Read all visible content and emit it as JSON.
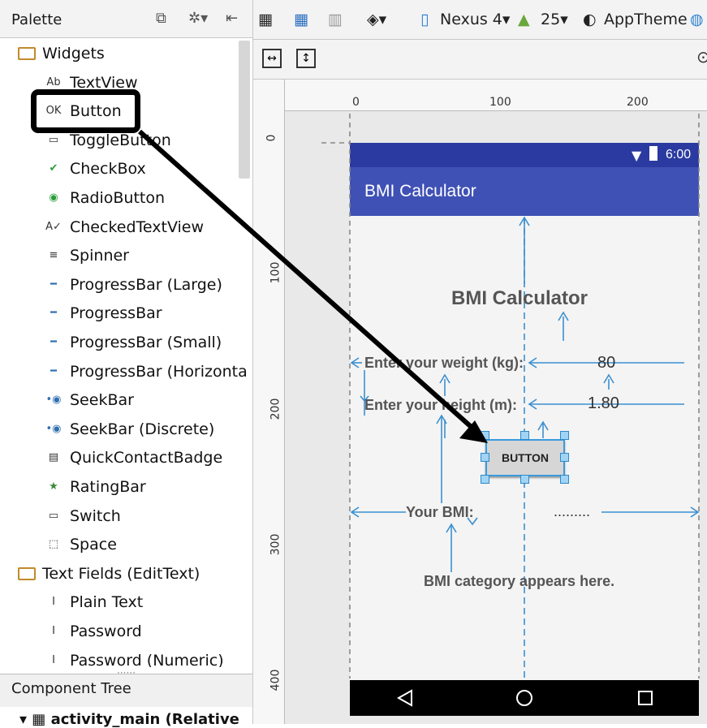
{
  "palette": {
    "title": "Palette",
    "items": [
      {
        "label": "Widgets",
        "icon": "folder-icon",
        "type": "folder"
      },
      {
        "label": "TextView",
        "icon": "textview-icon",
        "type": "item"
      },
      {
        "label": "Button",
        "icon": "button-icon",
        "type": "item"
      },
      {
        "label": "ToggleButton",
        "icon": "togglebutton-icon",
        "type": "item"
      },
      {
        "label": "CheckBox",
        "icon": "checkbox-icon",
        "type": "item"
      },
      {
        "label": "RadioButton",
        "icon": "radiobutton-icon",
        "type": "item"
      },
      {
        "label": "CheckedTextView",
        "icon": "checkedtextview-icon",
        "type": "item"
      },
      {
        "label": "Spinner",
        "icon": "spinner-icon",
        "type": "item"
      },
      {
        "label": "ProgressBar (Large)",
        "icon": "progressbar-icon",
        "type": "item"
      },
      {
        "label": "ProgressBar",
        "icon": "progressbar-icon",
        "type": "item"
      },
      {
        "label": "ProgressBar (Small)",
        "icon": "progressbar-icon",
        "type": "item"
      },
      {
        "label": "ProgressBar (Horizontal)",
        "icon": "progressbar-icon",
        "type": "item"
      },
      {
        "label": "SeekBar",
        "icon": "seekbar-icon",
        "type": "item"
      },
      {
        "label": "SeekBar (Discrete)",
        "icon": "seekbar-icon",
        "type": "item"
      },
      {
        "label": "QuickContactBadge",
        "icon": "contactbadge-icon",
        "type": "item"
      },
      {
        "label": "RatingBar",
        "icon": "star-icon",
        "type": "item"
      },
      {
        "label": "Switch",
        "icon": "switch-icon",
        "type": "item"
      },
      {
        "label": "Space",
        "icon": "space-icon",
        "type": "item"
      },
      {
        "label": "Text Fields (EditText)",
        "icon": "folder-icon",
        "type": "folder"
      },
      {
        "label": "Plain Text",
        "icon": "textfield-icon",
        "type": "item"
      },
      {
        "label": "Password",
        "icon": "textfield-icon",
        "type": "item"
      },
      {
        "label": "Password (Numeric)",
        "icon": "textfield-icon",
        "type": "item"
      }
    ]
  },
  "component_tree": {
    "title": "Component Tree",
    "root": "activity_main (Relative"
  },
  "toolbar": {
    "device": "Nexus 4",
    "api": "25",
    "theme": "AppTheme"
  },
  "rulers": {
    "h": [
      "0",
      "100",
      "200"
    ],
    "v": [
      "0",
      "100",
      "200",
      "300",
      "400"
    ]
  },
  "phone": {
    "time": "6:00",
    "app_title": "BMI Calculator",
    "heading": "BMI Calculator",
    "weight_label": "Enter your weight (kg):",
    "weight_value": "80",
    "height_label": "Enter your height (m):",
    "height_value": "1.80",
    "button_label": "BUTTON",
    "bmi_label": "Your BMI:",
    "bmi_value": ".........",
    "category": "BMI category appears here."
  },
  "colors": {
    "appbar": "#3f51b5",
    "statusbar": "#2a3aa0",
    "guide": "#3a8fd0"
  }
}
